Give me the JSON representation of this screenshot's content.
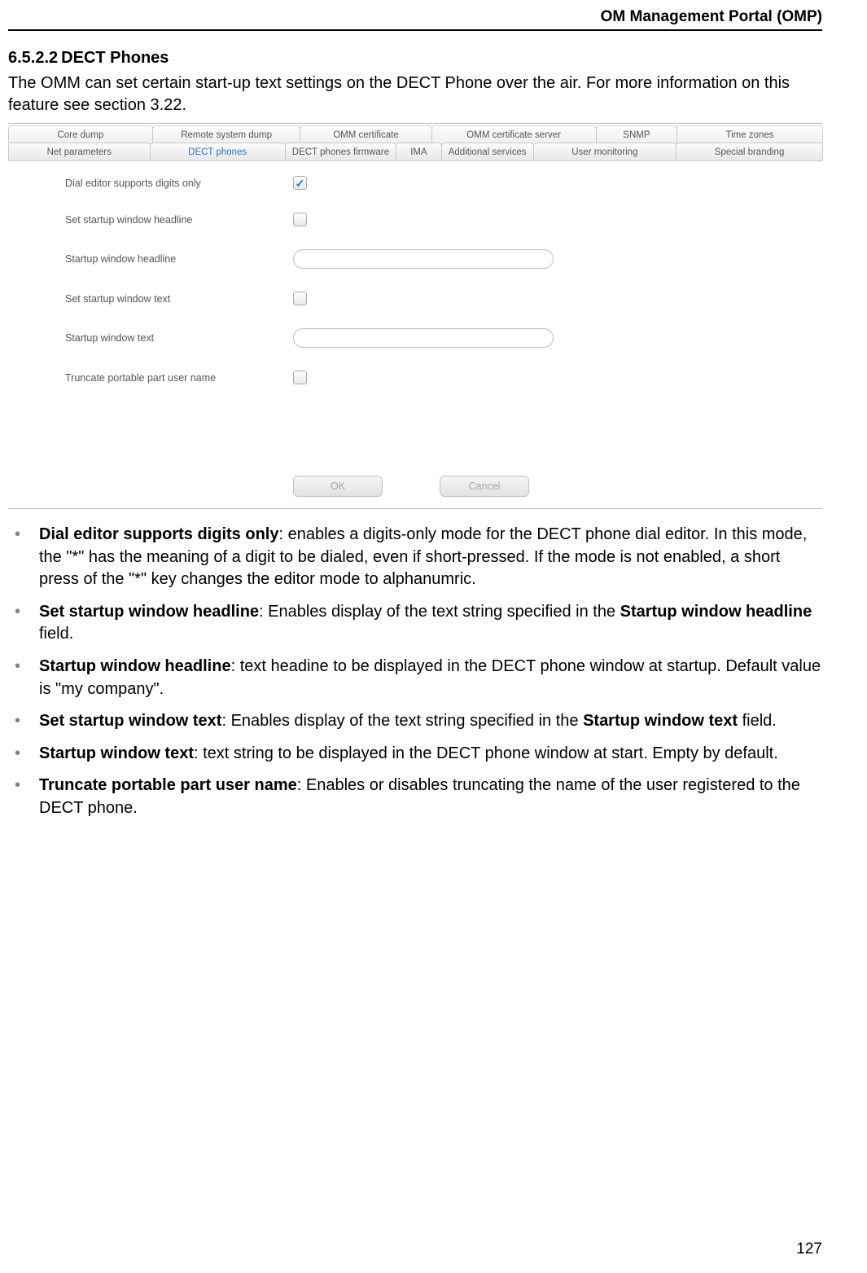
{
  "header": {
    "title": "OM Management Portal (OMP)"
  },
  "heading": {
    "number": "6.5.2.2",
    "title": "DECT Phones"
  },
  "intro": "The OMM can set certain start-up text settings on the DECT Phone over the air. For more information on this feature see section 3.22.",
  "ui": {
    "tabs_row1": [
      "Core dump",
      "Remote system dump",
      "OMM certificate",
      "OMM certificate server",
      "SNMP",
      "Time zones"
    ],
    "tabs_row2": [
      "Net parameters",
      "DECT phones",
      "DECT phones firmware",
      "IMA",
      "Additional services",
      "User monitoring",
      "Special branding"
    ],
    "active_tab": "DECT phones",
    "fields": [
      {
        "label": "Dial editor supports digits only",
        "type": "checkbox",
        "checked": true
      },
      {
        "label": "Set startup window headline",
        "type": "checkbox",
        "checked": false
      },
      {
        "label": "Startup window headline",
        "type": "text",
        "value": ""
      },
      {
        "label": "Set startup window text",
        "type": "checkbox",
        "checked": false
      },
      {
        "label": "Startup window text",
        "type": "text",
        "value": ""
      },
      {
        "label": "Truncate portable part user name",
        "type": "checkbox",
        "checked": false
      }
    ],
    "buttons": {
      "ok": "OK",
      "cancel": "Cancel"
    }
  },
  "bullets": [
    {
      "term": "Dial editor supports digits only",
      "desc": ": enables a digits-only mode for the DECT phone dial editor. In this mode, the \"*\" has the meaning of a digit to be dialed, even if short-pressed. If the mode is not enabled, a short press of the \"*\" key changes the editor mode to alphanumric."
    },
    {
      "term": "Set startup window headline",
      "desc_pre": ": Enables display of the text string specified in the ",
      "desc_bold": "Startup window headline",
      "desc_post": " field."
    },
    {
      "term": "Startup window headline",
      "desc": ": text headine to be displayed in the DECT phone window at startup. Default value is \"my company\"."
    },
    {
      "term": "Set startup window text",
      "desc_pre": ": Enables display of the text string specified in the ",
      "desc_bold": "Startup window text",
      "desc_post": " field."
    },
    {
      "term": "Startup window text",
      "desc": ": text string to be displayed in the DECT phone window at start. Empty by default."
    },
    {
      "term": "Truncate portable part user name",
      "desc": ": Enables or disables truncating the name of the user registered to the DECT phone."
    }
  ],
  "page_number": "127"
}
